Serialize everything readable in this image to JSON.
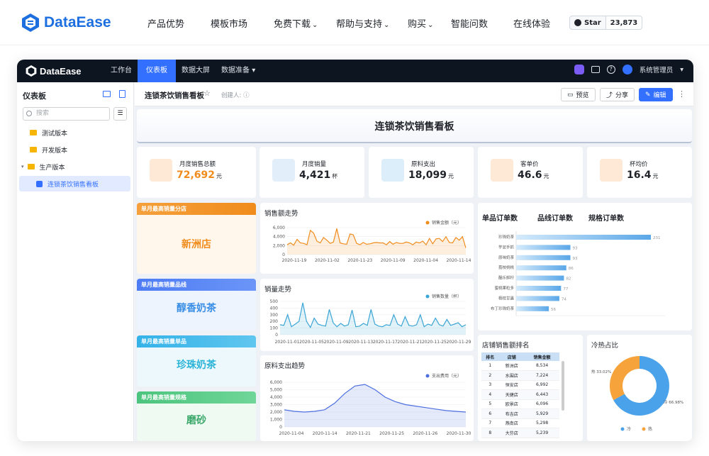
{
  "site": {
    "brand": "DataEase",
    "nav": [
      {
        "label": "产品优势",
        "dropdown": false
      },
      {
        "label": "模板市场",
        "dropdown": false
      },
      {
        "label": "免费下载",
        "dropdown": true
      },
      {
        "label": "帮助与支持",
        "dropdown": true
      },
      {
        "label": "购买",
        "dropdown": true
      },
      {
        "label": "智能问数",
        "dropdown": false
      },
      {
        "label": "在线体验",
        "dropdown": false
      }
    ],
    "github_star": "Star",
    "github_count": "23,873"
  },
  "app": {
    "brand": "DataEase",
    "tabs": [
      "工作台",
      "仪表板",
      "数据大屏",
      "数据准备"
    ],
    "active_tab": 1,
    "user": "系统管理员"
  },
  "sidebar": {
    "title": "仪表板",
    "search_placeholder": "搜索",
    "tree": [
      "测试版本",
      "开发版本",
      "生产版本",
      "连锁茶饮销售看板"
    ]
  },
  "header": {
    "title": "连锁茶饮销售看板",
    "creator": "创建人:",
    "preview": "预览",
    "share": "分享",
    "edit": "编辑"
  },
  "dashboard": {
    "title": "连锁茶饮销售看板",
    "kpis": [
      {
        "label": "月度销售总额",
        "value": "72,692",
        "unit": "元",
        "color": "#f08c1c",
        "bg": "#fde9d6"
      },
      {
        "label": "月度销量",
        "value": "4,421",
        "unit": "杯",
        "color": "#1f2329",
        "bg": "#e3eefb"
      },
      {
        "label": "原料支出",
        "value": "18,099",
        "unit": "元",
        "color": "#1f2329",
        "bg": "#dceefa"
      },
      {
        "label": "客单价",
        "value": "46.6",
        "unit": "元",
        "color": "#1f2329",
        "bg": "#fde9d6"
      },
      {
        "label": "杯均价",
        "value": "16.4",
        "unit": "元",
        "color": "#1f2329",
        "bg": "#fde9d6"
      }
    ],
    "side_cards": [
      {
        "header": "单月最高销量分店",
        "value": "新洲店",
        "hcolor": "#f5a03c",
        "vcolor": "#f08c1c",
        "bg": "#fff6ec"
      },
      {
        "header": "单月最高销量品线",
        "value": "醇香奶茶",
        "hcolor": "#4d7cf5",
        "vcolor": "#3a8ee6",
        "bg": "#eef4fd"
      },
      {
        "header": "单月最高销量单品",
        "value": "珍珠奶茶",
        "hcolor": "#34b2e8",
        "vcolor": "#2bb4d8",
        "bg": "#edf8fc"
      },
      {
        "header": "单月最高销量规格",
        "value": "磨砂",
        "hcolor": "#4cc47e",
        "vcolor": "#3aa86a",
        "bg": "#effaf2"
      }
    ],
    "tabs_right": [
      "单品订单数",
      "品线订单数",
      "规格订单数"
    ],
    "ranking": {
      "title": "店铺销售额排名",
      "headers": [
        "排名",
        "店铺",
        "销售金额"
      ],
      "rows": [
        [
          "1",
          "新洲店",
          "8,534"
        ],
        [
          "2",
          "水围店",
          "7,224"
        ],
        [
          "3",
          "恒安店",
          "6,992"
        ],
        [
          "4",
          "天健店",
          "6,443"
        ],
        [
          "5",
          "欧景店",
          "6,096"
        ],
        [
          "6",
          "布吉店",
          "5,929"
        ],
        [
          "7",
          "燕南店",
          "5,298"
        ],
        [
          "8",
          "大芬店",
          "5,239"
        ]
      ]
    },
    "pie_title": "冷热占比"
  },
  "chart_data": [
    {
      "type": "area",
      "title": "销售额走势",
      "series": [
        {
          "name": "销售金额（元）",
          "color": "#f08c1c",
          "values": [
            2200,
            2600,
            2100,
            3400,
            2600,
            2500,
            2200,
            5400,
            4800,
            3000,
            2600,
            3800,
            3200,
            2500,
            2800,
            5800,
            2600,
            2400,
            2300,
            4600,
            4400,
            2500,
            2200,
            2700,
            2300,
            2400,
            2600,
            2700,
            2600,
            2600,
            2200,
            2900,
            2300,
            2700,
            2500,
            2500,
            2800,
            2600,
            2200,
            2800,
            2600,
            3000,
            2200,
            3600,
            2400,
            3500,
            3600,
            2900,
            4000,
            2700,
            2600,
            3800,
            3200,
            4000,
            1500
          ]
        }
      ],
      "x_ticks": [
        "2020-11-19",
        "2020-11-02",
        "2020-11-23",
        "2020-11-09",
        "2020-11-04",
        "2020-11-14"
      ],
      "y_ticks": [
        "0",
        "2,000",
        "4,000",
        "6,000"
      ],
      "ylim": [
        0,
        6000
      ]
    },
    {
      "type": "area",
      "title": "销量走势",
      "series": [
        {
          "name": "销售数量（杯）",
          "color": "#3ba5d6",
          "values": [
            150,
            140,
            300,
            120,
            160,
            200,
            480,
            200,
            110,
            250,
            160,
            140,
            130,
            380,
            180,
            120,
            170,
            130,
            150,
            370,
            120,
            130,
            170,
            140,
            380,
            160,
            130,
            120,
            150,
            140,
            300,
            160,
            130,
            270,
            140,
            130,
            150,
            300,
            120,
            160,
            140,
            250,
            150,
            130,
            230,
            140,
            160,
            180,
            120,
            150
          ]
        }
      ],
      "x_ticks": [
        "2020-11-01",
        "2020-11-05",
        "2020-11-09",
        "2020-11-13",
        "2020-11-17",
        "2020-11-21",
        "2020-11-25",
        "2020-11-29"
      ],
      "y_ticks": [
        "0",
        "100",
        "200",
        "300",
        "400",
        "500"
      ],
      "ylim": [
        0,
        500
      ]
    },
    {
      "type": "area",
      "title": "原料支出趋势",
      "series": [
        {
          "name": "支出费用（元）",
          "color": "#4d6fe0",
          "values": [
            2300,
            2100,
            2000,
            2100,
            2300,
            3200,
            4500,
            5500,
            5700,
            5000,
            4000,
            3400,
            3000,
            2800,
            2600,
            2400,
            2200,
            2100,
            2000
          ]
        }
      ],
      "x_ticks": [
        "2020-11-04",
        "2020-11-14",
        "2020-11-21",
        "2020-11-25",
        "2020-11-26",
        "2020-11-30"
      ],
      "y_ticks": [
        "0",
        "1,000",
        "2,000",
        "3,000",
        "4,000",
        "5,000",
        "6,000"
      ],
      "ylim": [
        0,
        6000
      ]
    },
    {
      "type": "bar",
      "title": "单品订单数",
      "categories": [
        "珍珠奶茶",
        "芋泥手抓",
        "原味奶茶",
        "荔枝桃桃",
        "酷乐鲜柠",
        "蜜桃果粒多",
        "杨枝甘露",
        "布丁珍珠奶茶"
      ],
      "values": [
        231,
        93,
        93,
        86,
        82,
        77,
        74,
        56
      ],
      "color": "#5aa7e8"
    },
    {
      "type": "pie",
      "title": "冷热占比",
      "series": [
        {
          "name": "冷",
          "value": 66.98,
          "color": "#4aa3ea"
        },
        {
          "name": "热",
          "value": 33.02,
          "color": "#f7a33b"
        }
      ],
      "labels": [
        "热 33.02%",
        "冷 66.98%"
      ]
    }
  ]
}
